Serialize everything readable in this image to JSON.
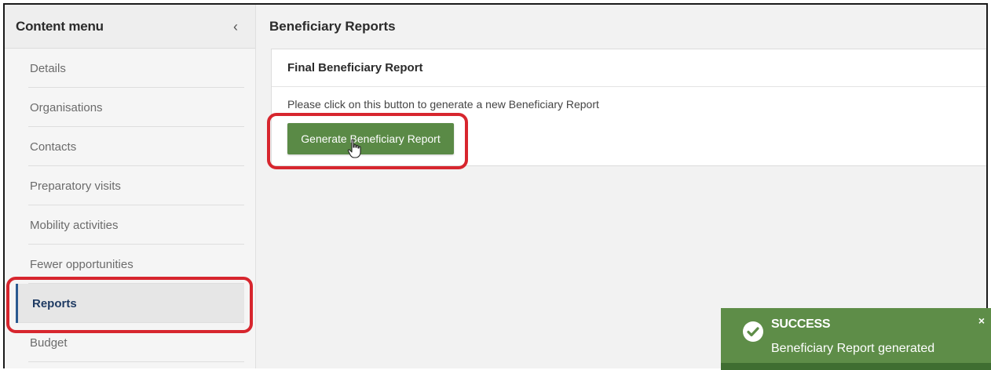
{
  "sidebar": {
    "title": "Content menu",
    "collapse_icon": "chevron-left-icon",
    "items": [
      {
        "label": "Details"
      },
      {
        "label": "Organisations"
      },
      {
        "label": "Contacts"
      },
      {
        "label": "Preparatory visits"
      },
      {
        "label": "Mobility activities"
      },
      {
        "label": "Fewer opportunities"
      },
      {
        "label": "Reports",
        "active": true
      },
      {
        "label": "Budget"
      }
    ]
  },
  "main": {
    "title": "Beneficiary Reports",
    "card": {
      "title": "Final Beneficiary Report",
      "text": "Please click on this button to generate a new Beneficiary Report",
      "button_label": "Generate Beneficiary Report"
    }
  },
  "toast": {
    "title": "SUCCESS",
    "message": "Beneficiary Report generated",
    "close_label": "×",
    "icon": "check-circle-icon"
  },
  "colors": {
    "accent_green": "#5a8a46",
    "highlight_red": "#d7262e",
    "active_blue": "#2b5a91"
  }
}
